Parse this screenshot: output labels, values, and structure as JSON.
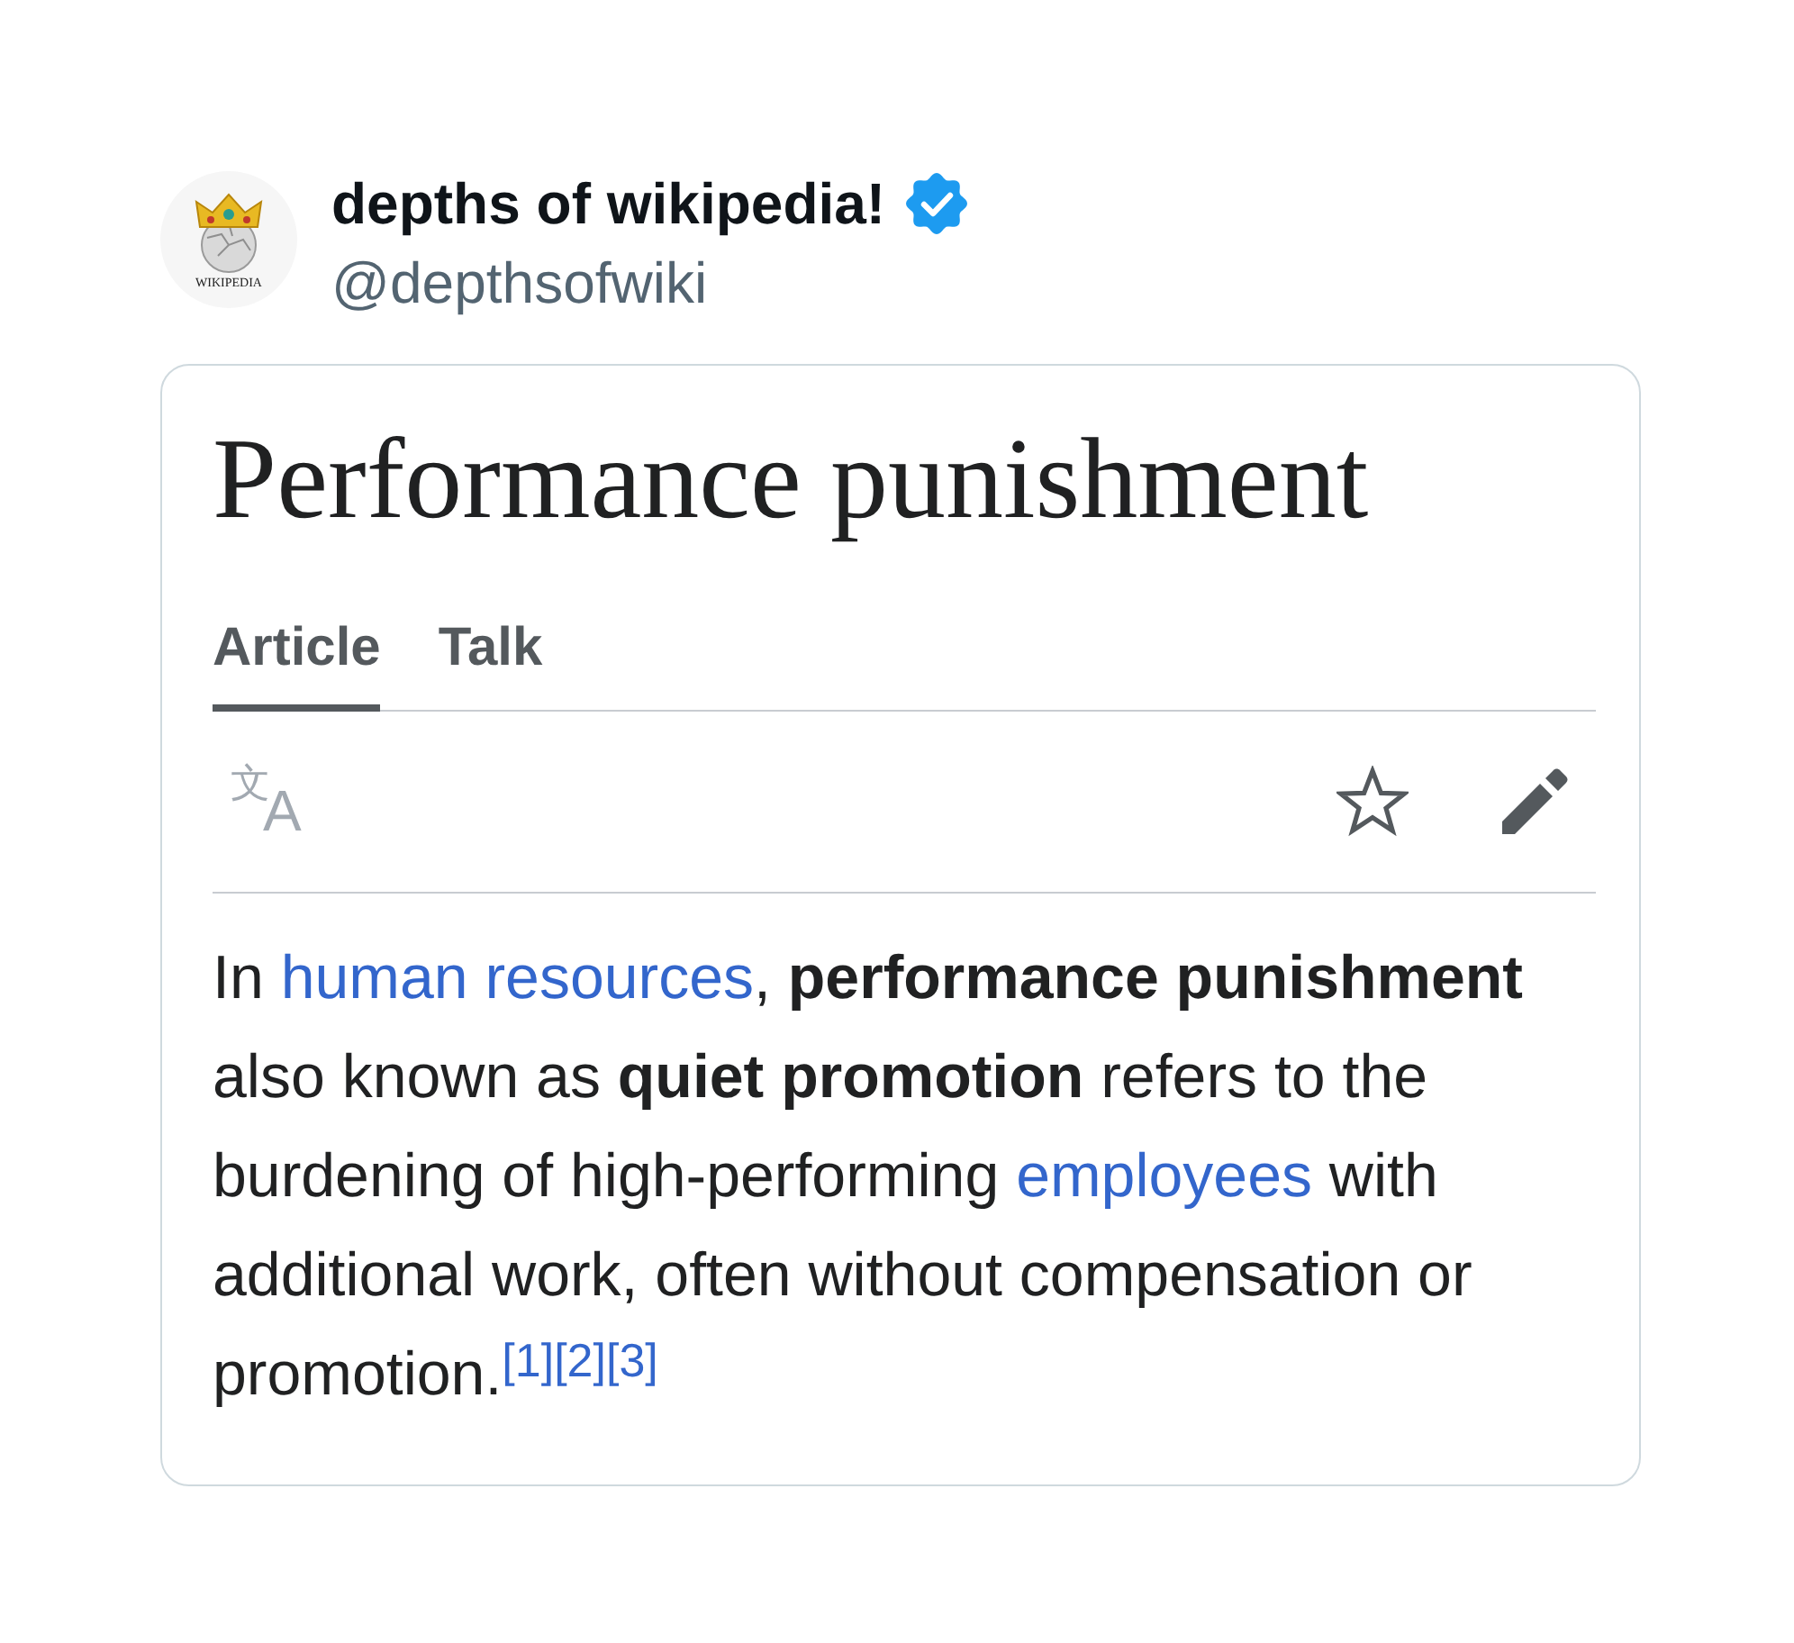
{
  "author": {
    "avatar": {
      "wordmark": "WIKIPEDIA"
    },
    "name": "depths of wikipedia!",
    "verified": true,
    "handle": "@depthsofwiki"
  },
  "article": {
    "title": "Performance punishment",
    "tabs": [
      {
        "label": "Article",
        "selected": true
      },
      {
        "label": "Talk",
        "selected": false
      }
    ],
    "toolbar": {
      "language_button": "文A",
      "watch_star": {
        "on": false
      }
    },
    "paragraph": [
      {
        "kind": "text",
        "text": "In "
      },
      {
        "kind": "link",
        "text": "human resources"
      },
      {
        "kind": "text",
        "text": ", **performance punishment** also known as **quiet promotion** refers to the burdening of high-performing "
      },
      {
        "kind": "link",
        "text": "employees"
      },
      {
        "kind": "text",
        "text": " with additional work, often without compensation or promotion."
      },
      {
        "kind": "cite",
        "text": "[1]"
      },
      {
        "kind": "cite",
        "text": "[2]"
      },
      {
        "kind": "cite",
        "text": "[3]"
      }
    ]
  }
}
